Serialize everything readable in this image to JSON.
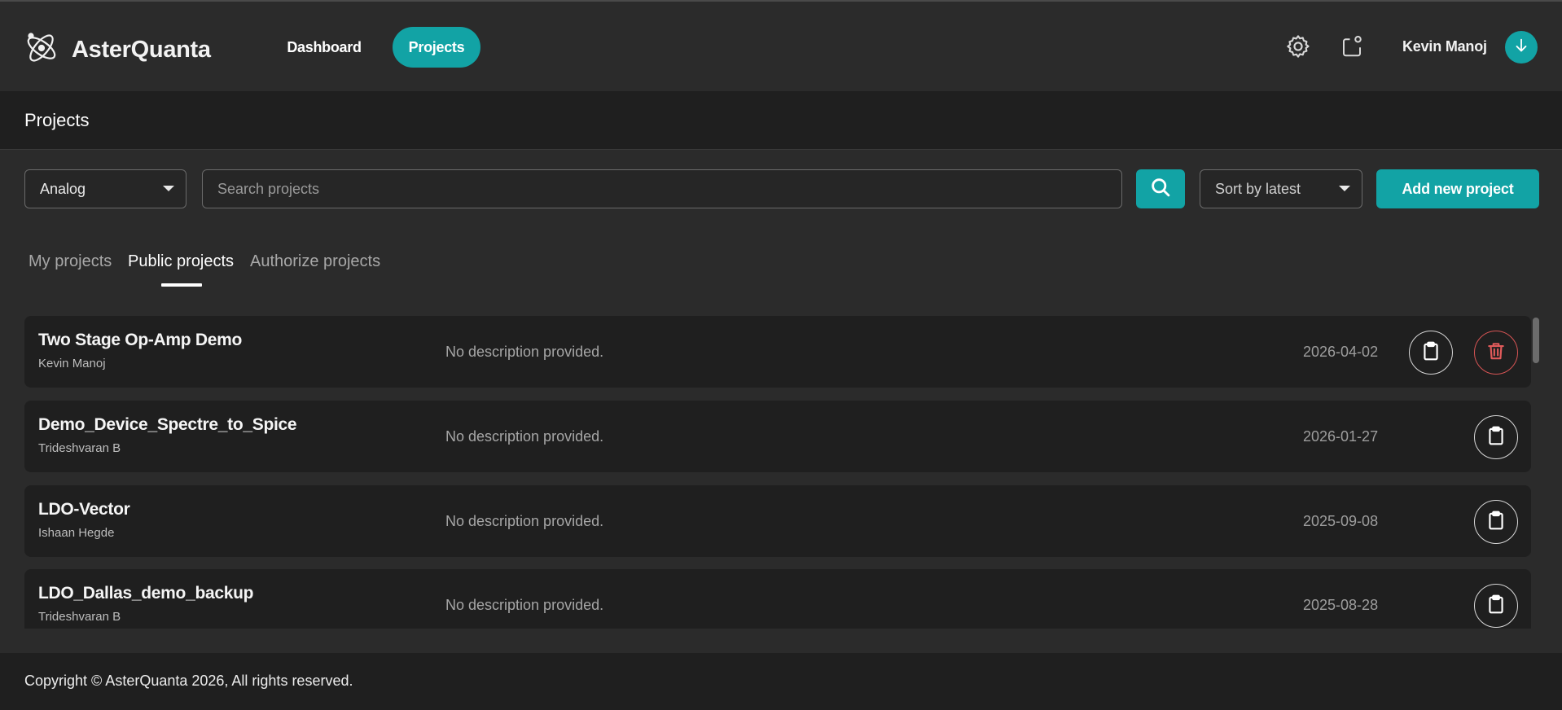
{
  "brand": {
    "name": "AsterQuanta",
    "logo_icon": "atom-logo-icon"
  },
  "nav": {
    "dashboard": "Dashboard",
    "projects": "Projects"
  },
  "header_icons": {
    "settings": "gear-icon",
    "share": "share-icon",
    "avatar": "arrow-down-icon"
  },
  "user": {
    "name": "Kevin Manoj"
  },
  "page": {
    "title": "Projects"
  },
  "controls": {
    "category_selected": "Analog",
    "search_placeholder": "Search projects",
    "search_value": "",
    "sort_selected": "Sort by latest",
    "add_label": "Add new project"
  },
  "tabs": [
    {
      "label": "My projects",
      "active": false
    },
    {
      "label": "Public projects",
      "active": true
    },
    {
      "label": "Authorize projects",
      "active": false
    }
  ],
  "projects": [
    {
      "title": "Two Stage Op-Amp Demo",
      "owner": "Kevin Manoj",
      "description": "No description provided.",
      "date": "2026-04-02",
      "deletable": true
    },
    {
      "title": "Demo_Device_Spectre_to_Spice",
      "owner": "Trideshvaran B",
      "description": "No description provided.",
      "date": "2026-01-27",
      "deletable": false
    },
    {
      "title": "LDO-Vector",
      "owner": "Ishaan Hegde",
      "description": "No description provided.",
      "date": "2025-09-08",
      "deletable": false
    },
    {
      "title": "LDO_Dallas_demo_backup",
      "owner": "Trideshvaran B",
      "description": "No description provided.",
      "date": "2025-08-28",
      "deletable": false
    }
  ],
  "footer": {
    "text": "Copyright © AsterQuanta 2026, All rights reserved."
  },
  "colors": {
    "accent": "#12a3a5",
    "danger": "#d65454",
    "background": "#2b2b2b",
    "panel": "#1f1f1f"
  }
}
